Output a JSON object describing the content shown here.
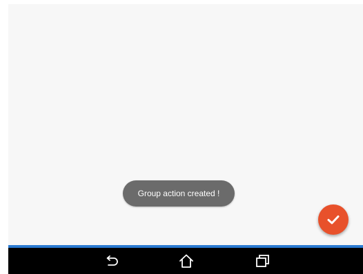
{
  "toast": {
    "message": "Group action created !"
  },
  "fab": {
    "icon": "checkmark-icon",
    "color": "#e8512b"
  },
  "navbar": {
    "background": "#000000",
    "accent": "#2b7ad1",
    "buttons": [
      {
        "icon": "back-icon"
      },
      {
        "icon": "home-icon"
      },
      {
        "icon": "recent-apps-icon"
      }
    ]
  }
}
